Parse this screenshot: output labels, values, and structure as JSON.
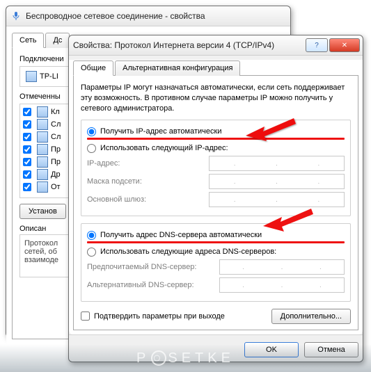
{
  "back": {
    "title": "Беспроводное сетевое соединение - свойства",
    "tabs": [
      "Сеть",
      "Дс"
    ],
    "connect_label": "Подключени",
    "adapter": "TP-LI",
    "checked_label": "Отмеченны",
    "items": [
      "Кл",
      "Сл",
      "Сл",
      "Пр",
      "Пр",
      "Др",
      "От"
    ],
    "install_btn": "Установ",
    "desc_label": "Описан",
    "desc_text": "Протокол\nсетей, об\nвзаимоде"
  },
  "front": {
    "title": "Свойства: Протокол Интернета версии 4 (TCP/IPv4)",
    "help": "?",
    "close": "✕",
    "tabs": [
      "Общие",
      "Альтернативная конфигурация"
    ],
    "intro": "Параметры IP могут назначаться автоматически, если сеть поддерживает эту возможность. В противном случае параметры IP можно получить у сетевого администратора.",
    "ip": {
      "auto": "Получить IP-адрес автоматически",
      "manual": "Использовать следующий IP-адрес:",
      "addr": "IP-адрес:",
      "mask": "Маска подсети:",
      "gw": "Основной шлюз:"
    },
    "dns": {
      "auto": "Получить адрес DNS-сервера автоматически",
      "manual": "Использовать следующие адреса DNS-серверов:",
      "pref": "Предпочитаемый DNS-сервер:",
      "alt": "Альтернативный DNS-сервер:"
    },
    "confirm": "Подтвердить параметры при выходе",
    "advanced": "Дополнительно...",
    "ok": "OK",
    "cancel": "Отмена"
  },
  "wm": "P  SETKE"
}
